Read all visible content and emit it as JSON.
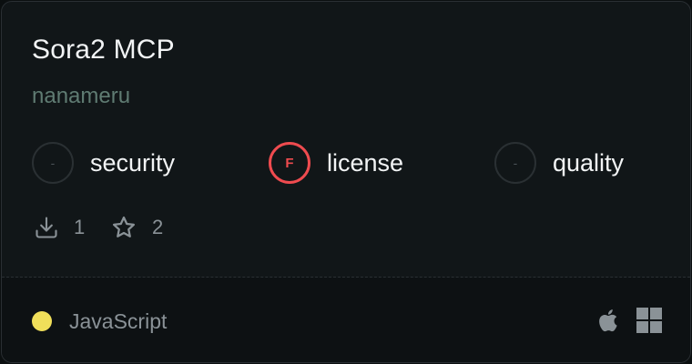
{
  "card": {
    "title": "Sora2 MCP",
    "author": "nanameru",
    "scores": [
      {
        "grade": "-",
        "label": "security",
        "status": "none"
      },
      {
        "grade": "F",
        "label": "license",
        "status": "fail"
      },
      {
        "grade": "-",
        "label": "quality",
        "status": "none"
      }
    ],
    "stats": {
      "downloads": "1",
      "stars": "2"
    },
    "footer": {
      "language": "JavaScript",
      "language_color": "#f0df5a",
      "platforms": [
        "apple-icon",
        "windows-icon"
      ]
    }
  },
  "colors": {
    "fail": "#ef4b4f",
    "author": "#5f7b72"
  }
}
